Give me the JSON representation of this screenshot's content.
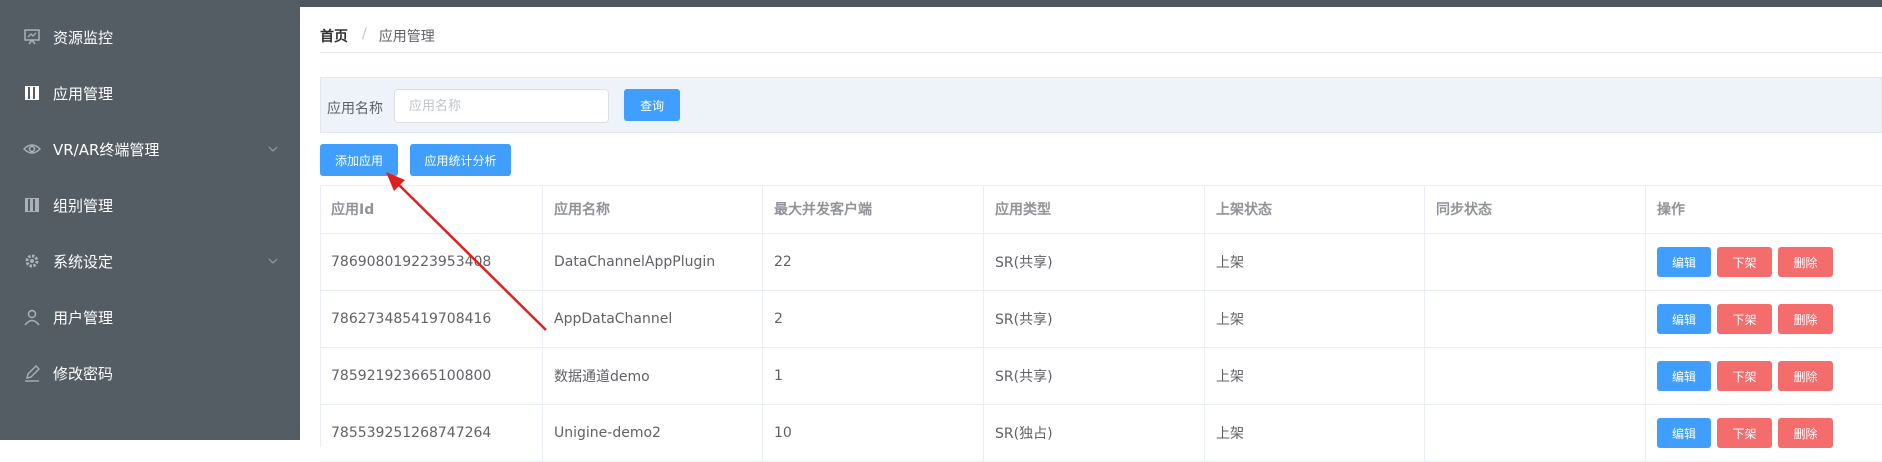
{
  "sidebar": {
    "items": [
      {
        "label": "资源监控",
        "icon": "monitor-icon"
      },
      {
        "label": "应用管理",
        "icon": "book-icon",
        "active": true
      },
      {
        "label": "VR/AR终端管理",
        "icon": "eye-icon",
        "has_children": true
      },
      {
        "label": "组别管理",
        "icon": "group-icon"
      },
      {
        "label": "系统设定",
        "icon": "gear-icon",
        "has_children": true
      },
      {
        "label": "用户管理",
        "icon": "user-icon"
      },
      {
        "label": "修改密码",
        "icon": "edit-icon"
      }
    ]
  },
  "breadcrumb": {
    "home": "首页",
    "separator": "/",
    "current": "应用管理"
  },
  "search": {
    "label": "应用名称",
    "placeholder": "应用名称",
    "value": "",
    "button": "查询"
  },
  "toolbar": {
    "add_label": "添加应用",
    "stats_label": "应用统计分析"
  },
  "table": {
    "columns": [
      "应用Id",
      "应用名称",
      "最大并发客户端",
      "应用类型",
      "上架状态",
      "同步状态",
      "操作"
    ],
    "rows": [
      [
        "786908019223953408",
        "DataChannelAppPlugin",
        "22",
        "SR(共享)",
        "上架",
        ""
      ],
      [
        "786273485419708416",
        "AppDataChannel",
        "2",
        "SR(共享)",
        "上架",
        ""
      ],
      [
        "785921923665100800",
        "数据通道demo",
        "1",
        "SR(共享)",
        "上架",
        ""
      ],
      [
        "785539251268747264",
        "Unigine-demo2",
        "10",
        "SR(独占)",
        "上架",
        ""
      ]
    ],
    "actions": {
      "edit": "编辑",
      "off_shelf": "下架",
      "delete": "删除"
    }
  },
  "colors": {
    "primary": "#409eff",
    "danger": "#f56c6c",
    "sidebar": "#545c64",
    "annotation_arrow": "#e02020"
  }
}
